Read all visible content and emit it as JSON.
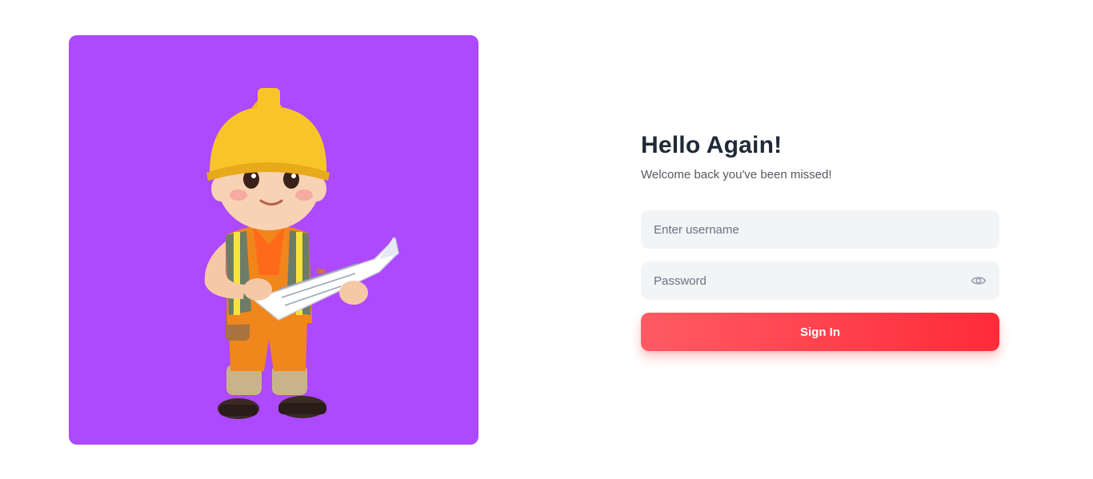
{
  "illustration": {
    "icon": "construction-worker-illustration",
    "background_color": "#ad49ff"
  },
  "login": {
    "title": "Hello Again!",
    "subtitle": "Welcome back you've been missed!",
    "username_placeholder": "Enter username",
    "username_value": "",
    "password_placeholder": "Password",
    "password_value": "",
    "password_toggle_icon": "eye-icon",
    "submit_label": "Sign In",
    "accent_color": "#ff3b47"
  }
}
